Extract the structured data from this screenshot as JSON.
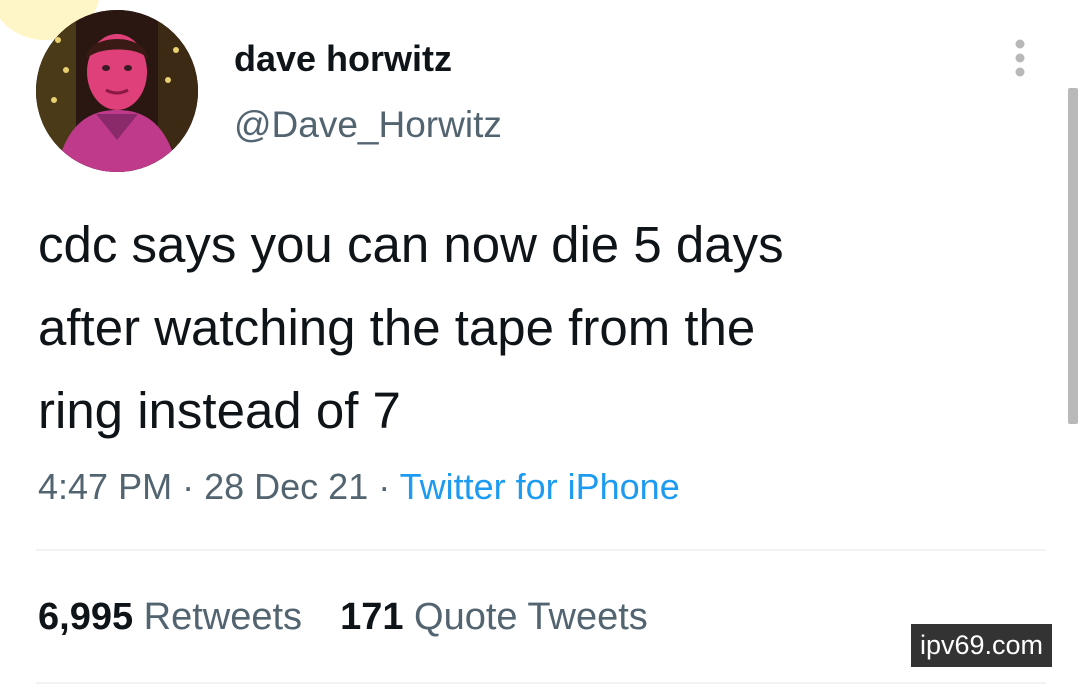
{
  "author": {
    "display_name": "dave horwitz",
    "handle": "@Dave_Horwitz",
    "avatar_icon": "profile-photo"
  },
  "tweet": {
    "text_lines": [
      "cdc says you can now die 5 days",
      "after watching the tape from the",
      "ring instead of 7"
    ],
    "time": "4:47 PM",
    "separator": "·",
    "date": "28 Dec 21",
    "source": "Twitter for iPhone"
  },
  "stats": {
    "retweets_count": "6,995",
    "retweets_label": "Retweets",
    "quotes_count": "171",
    "quotes_label": "Quote Tweets"
  },
  "watermark": "ipv69.com",
  "colors": {
    "text_primary": "#0f1419",
    "text_secondary": "#536471",
    "link": "#1d9bf0",
    "divider": "#eff3f4"
  }
}
